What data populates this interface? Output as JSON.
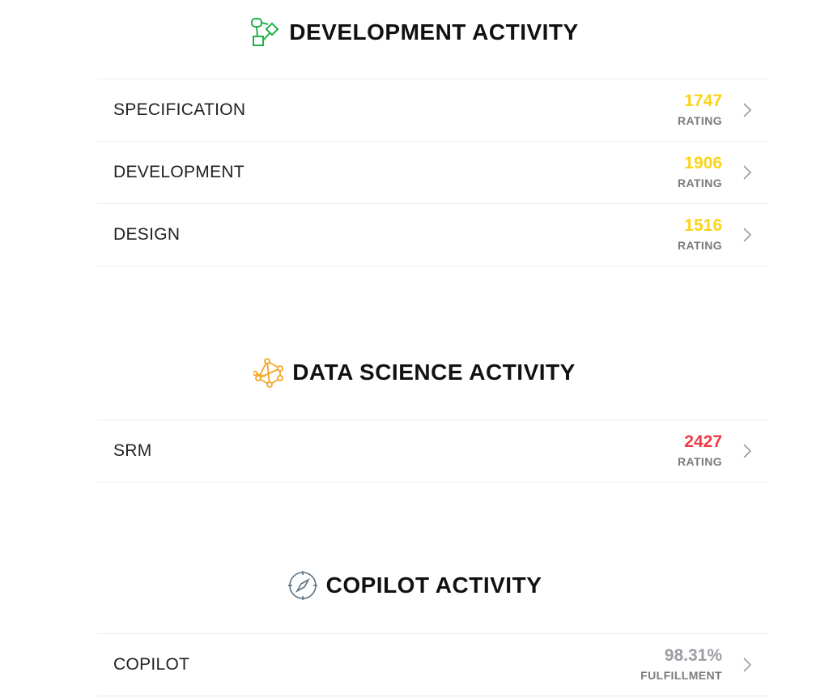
{
  "colors": {
    "dev_icon": "#21b24b",
    "ds_icon": "#f5a623",
    "copilot_icon": "#5a7180",
    "rating_yellow": "#fbd318",
    "rating_red": "#ef3a45",
    "fulfillment_gray": "#9a9ea3",
    "chevron": "#9b9b9b"
  },
  "sections": [
    {
      "title": "DEVELOPMENT ACTIVITY",
      "icon": "flowchart-icon",
      "rows": [
        {
          "label": "SPECIFICATION",
          "value": "1747",
          "unit": "RATING"
        },
        {
          "label": "DEVELOPMENT",
          "value": "1906",
          "unit": "RATING"
        },
        {
          "label": "DESIGN",
          "value": "1516",
          "unit": "RATING"
        }
      ]
    },
    {
      "title": "DATA SCIENCE ACTIVITY",
      "icon": "network-graph-icon",
      "rows": [
        {
          "label": "SRM",
          "value": "2427",
          "unit": "RATING"
        }
      ]
    },
    {
      "title": "COPILOT ACTIVITY",
      "icon": "compass-icon",
      "rows": [
        {
          "label": "COPILOT",
          "value": "98.31%",
          "unit": "FULFILLMENT"
        }
      ]
    }
  ]
}
